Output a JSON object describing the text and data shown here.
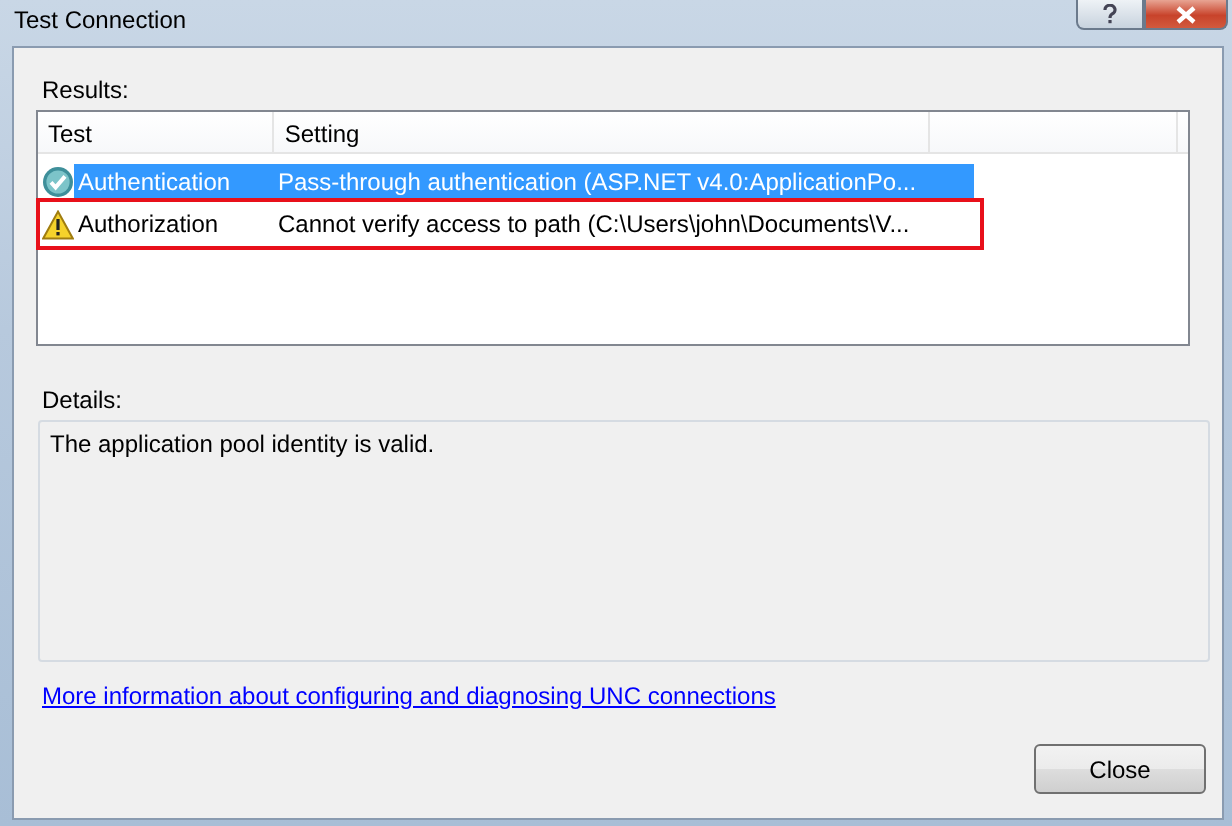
{
  "window": {
    "title": "Test Connection"
  },
  "results": {
    "label": "Results:",
    "columns": [
      "Test",
      "Setting"
    ],
    "rows": [
      {
        "kind": "success",
        "test": "Authentication",
        "setting": "Pass-through authentication (ASP.NET v4.0:ApplicationPo...",
        "selected": true,
        "outlined": false
      },
      {
        "kind": "warning",
        "test": "Authorization",
        "setting": "Cannot verify access to path (C:\\Users\\john\\Documents\\V...",
        "selected": false,
        "outlined": true
      }
    ]
  },
  "details": {
    "label": "Details:",
    "text": "The application pool identity is valid."
  },
  "link": "More information about configuring and diagnosing UNC connections",
  "buttons": [
    "Close"
  ]
}
